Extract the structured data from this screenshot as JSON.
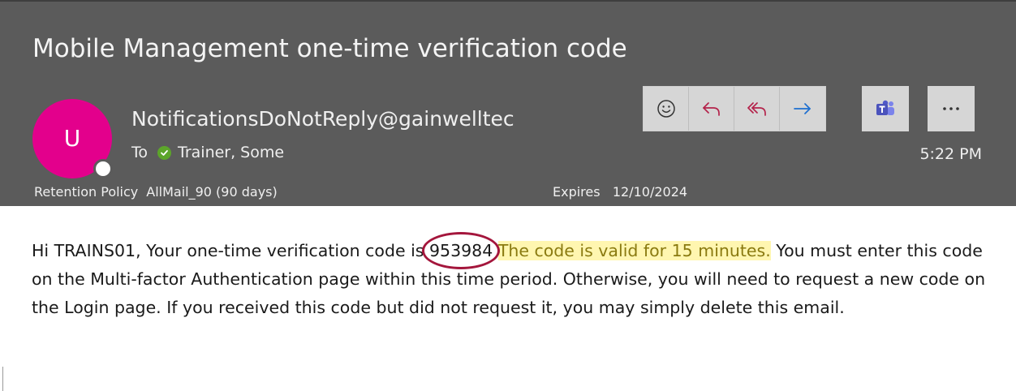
{
  "email": {
    "subject": "Mobile Management one-time verification code",
    "avatar_initial": "U",
    "sender": "NotificationsDoNotReply@gainwelltec",
    "to_label": "To",
    "recipient": "Trainer, Some",
    "time": "5:22 PM",
    "retention_label": "Retention Policy",
    "retention_value": "AllMail_90 (90 days)",
    "expires_label": "Expires",
    "expires_value": "12/10/2024"
  },
  "actions": [
    {
      "name": "emoji-react-button",
      "icon": "smiley-icon"
    },
    {
      "name": "reply-button",
      "icon": "reply-icon"
    },
    {
      "name": "reply-all-button",
      "icon": "reply-all-icon"
    },
    {
      "name": "forward-button",
      "icon": "forward-arrow-icon"
    },
    {
      "name": "teams-button",
      "icon": "teams-icon"
    },
    {
      "name": "more-options-button",
      "icon": "ellipsis-icon"
    }
  ],
  "body": {
    "intro": "Hi TRAINS01, Your one-time verification code is",
    "code": "953984",
    "highlighted": "The code is valid for 15 minutes.",
    "rest": "You must enter this code on the Multi-factor Authentication page within this time period. Otherwise, you will need to request a new code on the Login page. If you received this code but did not request it, you may simply delete this email."
  },
  "colors": {
    "header_bg": "#5b5b5b",
    "avatar_bg": "#e3008c",
    "accent_red": "#a4163c",
    "action_blue": "#1e6fd0",
    "highlight": "#fff6b0"
  }
}
